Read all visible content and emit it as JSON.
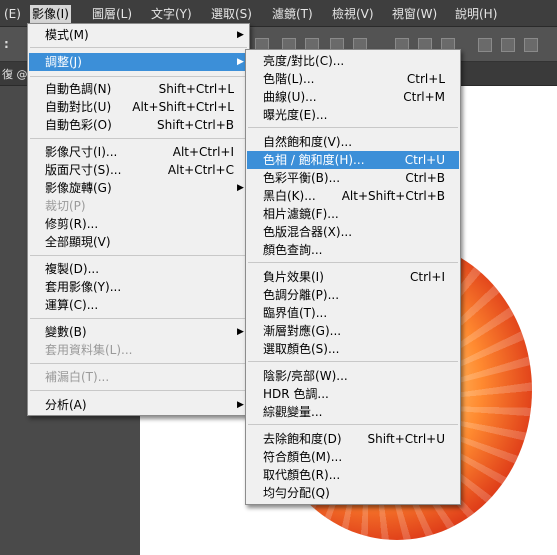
{
  "menubar": {
    "items": [
      "(E)",
      "影像(I)",
      "圖層(L)",
      "文字(Y)",
      "選取(S)",
      "濾鏡(T)",
      "檢視(V)",
      "視窗(W)",
      "說明(H)"
    ]
  },
  "optionsbar": {
    "label": ":"
  },
  "document": {
    "tab_label": "復 @"
  },
  "image_menu": {
    "items": [
      {
        "label": "模式(M)",
        "shortcut": "",
        "submenu": true
      },
      {
        "label": "調整(J)",
        "shortcut": "",
        "submenu": true
      },
      {
        "label": "自動色調(N)",
        "shortcut": "Shift+Ctrl+L"
      },
      {
        "label": "自動對比(U)",
        "shortcut": "Alt+Shift+Ctrl+L"
      },
      {
        "label": "自動色彩(O)",
        "shortcut": "Shift+Ctrl+B"
      },
      {
        "label": "影像尺寸(I)...",
        "shortcut": "Alt+Ctrl+I"
      },
      {
        "label": "版面尺寸(S)...",
        "shortcut": "Alt+Ctrl+C"
      },
      {
        "label": "影像旋轉(G)",
        "shortcut": "",
        "submenu": true
      },
      {
        "label": "裁切(P)",
        "shortcut": "",
        "disabled": true
      },
      {
        "label": "修剪(R)...",
        "shortcut": ""
      },
      {
        "label": "全部顯現(V)",
        "shortcut": ""
      },
      {
        "label": "複製(D)...",
        "shortcut": ""
      },
      {
        "label": "套用影像(Y)...",
        "shortcut": ""
      },
      {
        "label": "運算(C)...",
        "shortcut": ""
      },
      {
        "label": "變數(B)",
        "shortcut": "",
        "submenu": true
      },
      {
        "label": "套用資料集(L)...",
        "shortcut": "",
        "disabled": true
      },
      {
        "label": "補漏白(T)...",
        "shortcut": "",
        "disabled": true
      },
      {
        "label": "分析(A)",
        "shortcut": "",
        "submenu": true
      }
    ]
  },
  "adjust_menu": {
    "items": [
      {
        "label": "亮度/對比(C)...",
        "shortcut": ""
      },
      {
        "label": "色階(L)...",
        "shortcut": "Ctrl+L"
      },
      {
        "label": "曲線(U)...",
        "shortcut": "Ctrl+M"
      },
      {
        "label": "曝光度(E)...",
        "shortcut": ""
      },
      {
        "label": "自然飽和度(V)...",
        "shortcut": ""
      },
      {
        "label": "色相 / 飽和度(H)...",
        "shortcut": "Ctrl+U"
      },
      {
        "label": "色彩平衡(B)...",
        "shortcut": "Ctrl+B"
      },
      {
        "label": "黑白(K)...",
        "shortcut": "Alt+Shift+Ctrl+B"
      },
      {
        "label": "相片濾鏡(F)...",
        "shortcut": ""
      },
      {
        "label": "色版混合器(X)...",
        "shortcut": ""
      },
      {
        "label": "顏色查詢...",
        "shortcut": ""
      },
      {
        "label": "負片效果(I)",
        "shortcut": "Ctrl+I"
      },
      {
        "label": "色調分離(P)...",
        "shortcut": ""
      },
      {
        "label": "臨界值(T)...",
        "shortcut": ""
      },
      {
        "label": "漸層對應(G)...",
        "shortcut": ""
      },
      {
        "label": "選取顏色(S)...",
        "shortcut": ""
      },
      {
        "label": "陰影/亮部(W)...",
        "shortcut": ""
      },
      {
        "label": "HDR 色調...",
        "shortcut": ""
      },
      {
        "label": "綜觀變量...",
        "shortcut": ""
      },
      {
        "label": "去除飽和度(D)",
        "shortcut": "Shift+Ctrl+U"
      },
      {
        "label": "符合顏色(M)...",
        "shortcut": ""
      },
      {
        "label": "取代顏色(R)...",
        "shortcut": ""
      },
      {
        "label": "均勻分配(Q)",
        "shortcut": ""
      }
    ]
  },
  "colors": {
    "highlight": "#3c8fd8",
    "menu_bg": "#f0f0f0",
    "menubar_bg": "#3e3e3e"
  }
}
